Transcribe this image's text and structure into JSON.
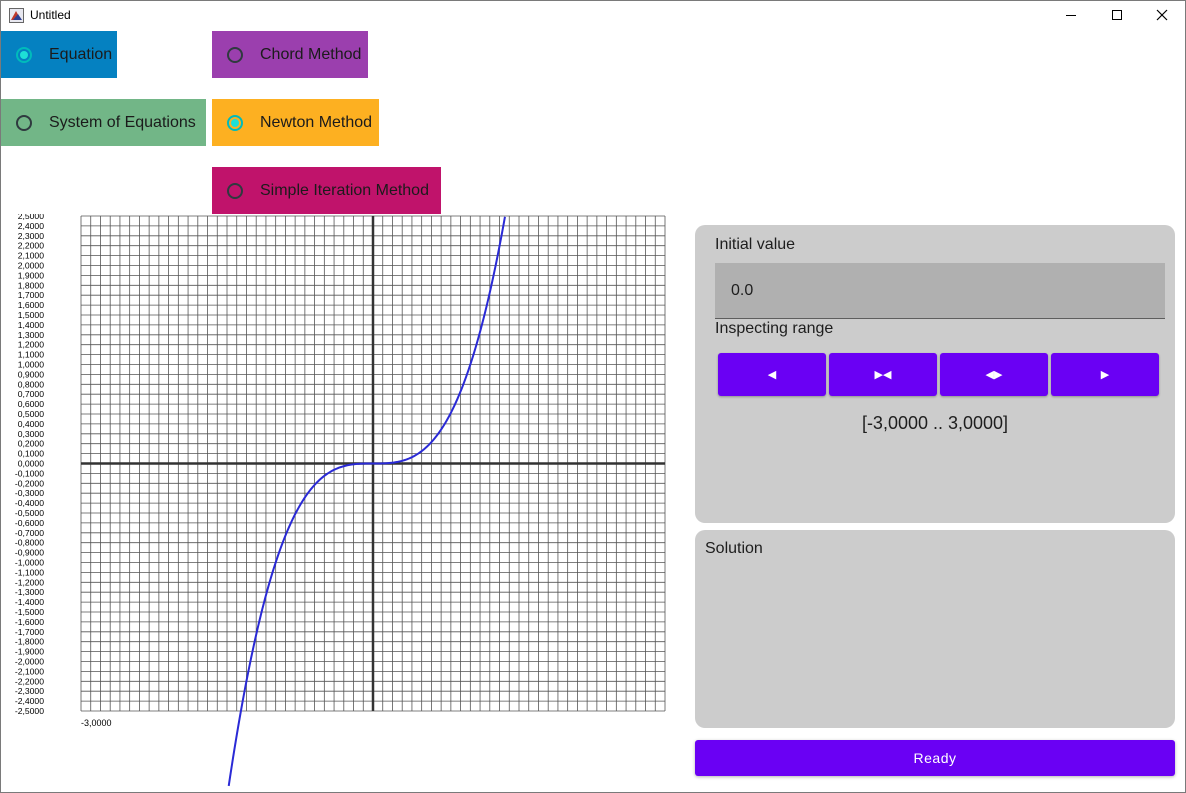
{
  "window": {
    "title": "Untitled"
  },
  "modes": [
    {
      "label": "Equation",
      "selected": true,
      "color": "#0581c1"
    },
    {
      "label": "System of Equations",
      "selected": false,
      "color": "#72b687"
    }
  ],
  "methods": [
    {
      "label": "Chord Method",
      "selected": false,
      "color": "#9b3fae"
    },
    {
      "label": "Newton Method",
      "selected": true,
      "color": "#fdb021"
    },
    {
      "label": "Simple Iteration Method",
      "selected": false,
      "color": "#c0136b"
    }
  ],
  "params": {
    "initial_label": "Initial value",
    "initial_value": "0.0",
    "range_label": "Inspecting range",
    "buttons": [
      "◀",
      "▶◀",
      "◀▶",
      "▶"
    ],
    "range_text": "[-3,0000 .. 3,0000]"
  },
  "solution": {
    "label": "Solution"
  },
  "ready_label": "Ready",
  "chart_data": {
    "type": "line",
    "function": "x^3",
    "xlim": [
      -3,
      3
    ],
    "ylim": [
      -2.5,
      2.5
    ],
    "x_tick_label": "-3,0000",
    "y_tick_labels": [
      "2,5000",
      "2,4000",
      "2,3000",
      "2,2000",
      "2,1000",
      "2,0000",
      "1,9000",
      "1,8000",
      "1,7000",
      "1,6000",
      "1,5000",
      "1,4000",
      "1,3000",
      "1,2000",
      "1,1000",
      "1,0000",
      "0,9000",
      "0,8000",
      "0,7000",
      "0,6000",
      "0,5000",
      "0,4000",
      "0,3000",
      "0,2000",
      "0,1000",
      "0,0000",
      "-0,1000",
      "-0,2000",
      "-0,3000",
      "-0,4000",
      "-0,5000",
      "-0,6000",
      "-0,7000",
      "-0,8000",
      "-0,9000",
      "-1,0000",
      "-1,1000",
      "-1,2000",
      "-1,3000",
      "-1,4000",
      "-1,5000",
      "-1,6000",
      "-1,7000",
      "-1,8000",
      "-1,9000",
      "-2,0000",
      "-2,1000",
      "-2,2000",
      "-2,3000",
      "-2,4000",
      "-2,5000"
    ],
    "grid": true,
    "line_color": "#2a2ad6"
  }
}
